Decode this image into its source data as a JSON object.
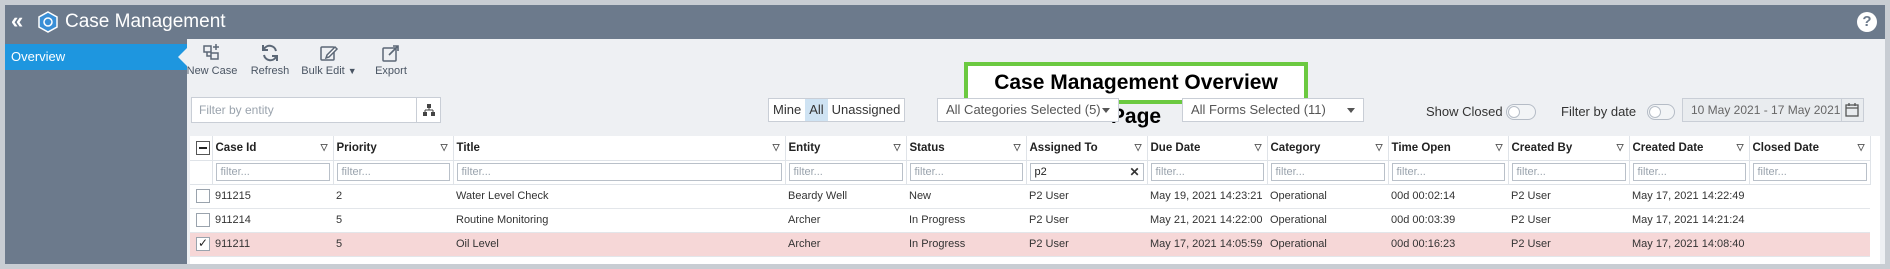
{
  "header": {
    "title": "Case Management",
    "help_icon": "question-icon"
  },
  "sidebar": {
    "items": [
      {
        "label": "Overview",
        "active": true
      }
    ]
  },
  "annotation": {
    "label": "Case Management Overview Page"
  },
  "toolbar": {
    "new_case": "New Case",
    "refresh": "Refresh",
    "bulk_edit": "Bulk Edit",
    "export": "Export"
  },
  "filters": {
    "entity_placeholder": "Filter by entity",
    "scope": {
      "mine": "Mine",
      "all": "All",
      "unassigned": "Unassigned",
      "selected": "All"
    },
    "categories": "All Categories Selected (5)",
    "forms": "All Forms Selected (11)",
    "show_closed_label": "Show Closed",
    "show_closed": false,
    "filter_by_date_label": "Filter by date",
    "filter_by_date": false,
    "date_range": "10 May 2021 - 17 May 2021"
  },
  "table": {
    "columns": [
      "Case Id",
      "Priority",
      "Title",
      "Entity",
      "Status",
      "Assigned To",
      "Due Date",
      "Category",
      "Time Open",
      "Created By",
      "Created Date",
      "Closed Date"
    ],
    "filter_placeholder": "filter...",
    "assigned_filter_value": "p2",
    "rows": [
      {
        "checked": false,
        "cells": [
          "911215",
          "2",
          "Water Level Check",
          "Beardy Well",
          "New",
          "P2 User",
          "May 19, 2021 14:23:21",
          "Operational",
          "00d 00:02:14",
          "P2 User",
          "May 17, 2021 14:22:49",
          ""
        ]
      },
      {
        "checked": false,
        "cells": [
          "911214",
          "5",
          "Routine Monitoring",
          "Archer",
          "In Progress",
          "P2 User",
          "May 21, 2021 14:22:00",
          "Operational",
          "00d 00:03:39",
          "P2 User",
          "May 17, 2021 14:21:24",
          ""
        ]
      },
      {
        "checked": true,
        "cells": [
          "911211",
          "5",
          "Oil Level",
          "Archer",
          "In Progress",
          "P2 User",
          "May 17, 2021 14:05:59",
          "Operational",
          "00d 00:16:23",
          "P2 User",
          "May 17, 2021 14:08:40",
          ""
        ]
      }
    ]
  },
  "colors": {
    "header": "#6c7a8c",
    "active_nav": "#1e96df",
    "selected_row": "#f6d7d7",
    "annotation_border": "#6bc940"
  }
}
